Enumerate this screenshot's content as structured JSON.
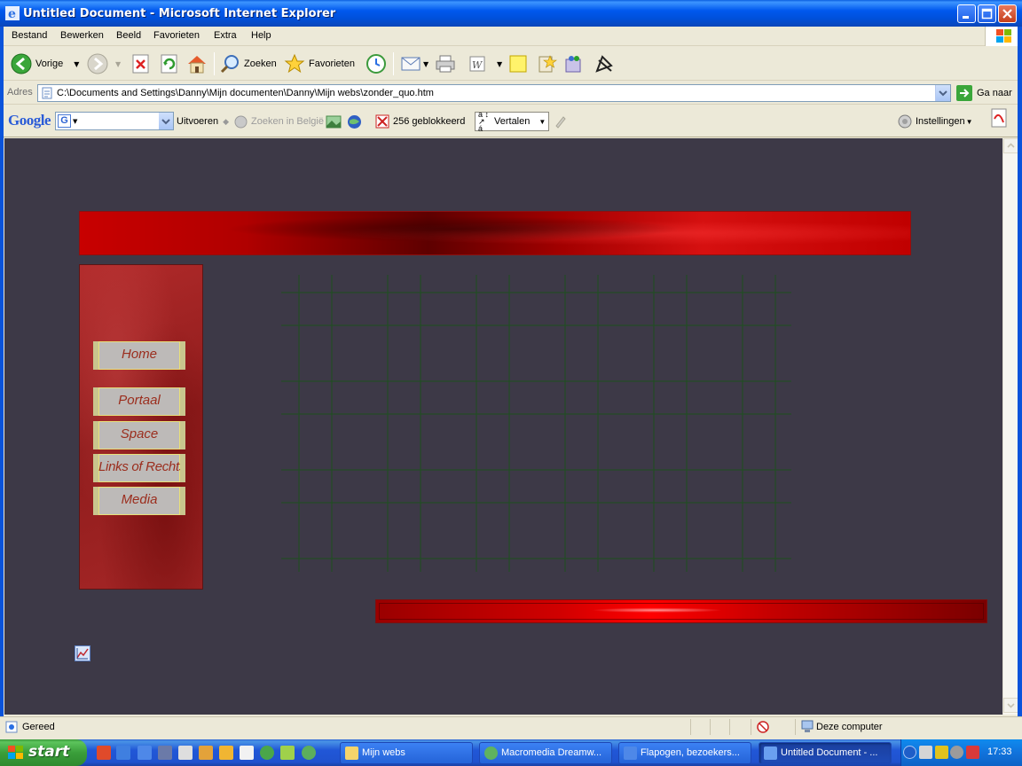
{
  "window": {
    "title": "Untitled Document - Microsoft Internet Explorer"
  },
  "menu": [
    "Bestand",
    "Bewerken",
    "Beeld",
    "Favorieten",
    "Extra",
    "Help"
  ],
  "toolbar": {
    "back_label": "Vorige",
    "search_label": "Zoeken",
    "favorites_label": "Favorieten"
  },
  "address": {
    "label": "Adres",
    "value": "C:\\Documents and Settings\\Danny\\Mijn documenten\\Danny\\Mijn webs\\zonder_quo.htm",
    "go_label": "Ga naar"
  },
  "google_toolbar": {
    "logo_text": "Google",
    "search_engine_letter": "G",
    "search_button": "Uitvoeren",
    "search_belgium": "Zoeken in België",
    "popups_blocked": "256 geblokkeerd",
    "translate": "Vertalen",
    "settings": "Instellingen"
  },
  "page": {
    "nav_buttons": [
      "Home",
      "Portaal",
      "Space",
      "Links of Rechts",
      "Media"
    ],
    "colors": {
      "background": "#3d3947",
      "banner_red": "#c80000",
      "nav_text": "#9b2d1d",
      "grid_line": "#1e5a1e"
    }
  },
  "status": {
    "text": "Gereed",
    "zone": "Deze computer"
  },
  "taskbar": {
    "start_label": "start",
    "tasks": [
      {
        "label": "Mijn webs",
        "active": false
      },
      {
        "label": "Macromedia Dreamw...",
        "active": false
      },
      {
        "label": "Flapogen, bezoekers...",
        "active": false
      },
      {
        "label": "Untitled Document - ...",
        "active": true
      }
    ],
    "clock": "17:33"
  }
}
